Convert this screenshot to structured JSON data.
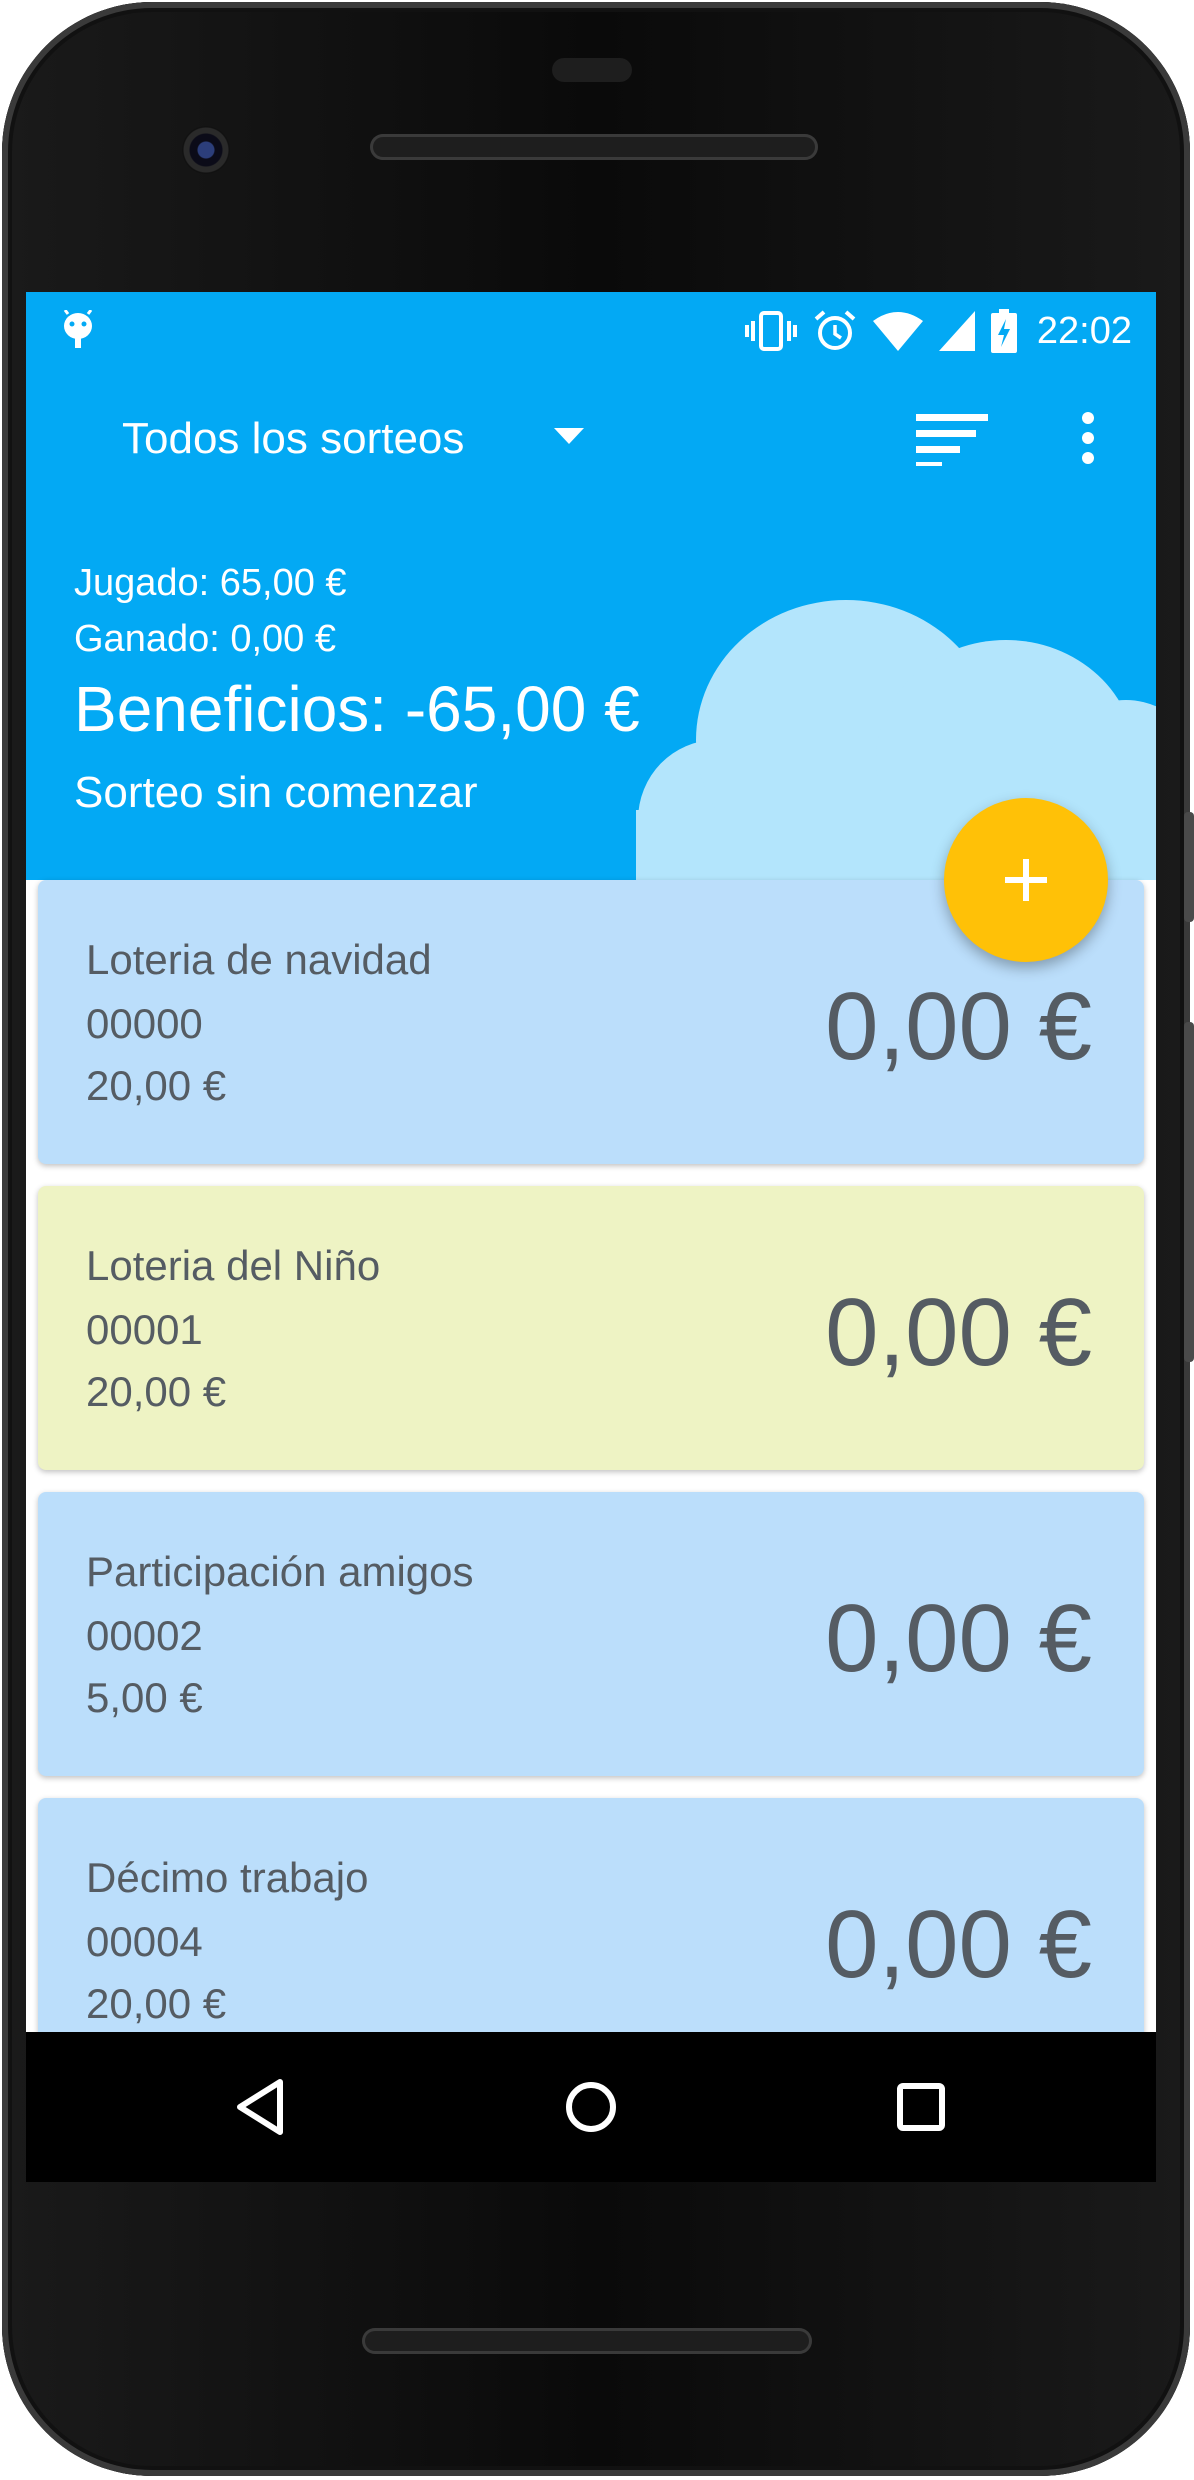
{
  "status_bar": {
    "time": "22:02",
    "icons": [
      "android-icon",
      "vibrate-icon",
      "alarm-icon",
      "wifi-icon",
      "signal-icon",
      "battery-charging-icon"
    ]
  },
  "toolbar": {
    "title": "Todos los sorteos",
    "icons": [
      "dropdown-arrow-icon",
      "sort-icon",
      "more-vert-icon"
    ]
  },
  "summary": {
    "played": "Jugado: 65,00 €",
    "won": "Ganado: 0,00 €",
    "profit": "Beneficios: -65,00 €",
    "status": "Sorteo sin comenzar"
  },
  "fab": {
    "icon": "add-icon",
    "label": "+"
  },
  "tickets": [
    {
      "name": "Loteria de navidad",
      "number": "00000",
      "price": "20,00 €",
      "prize": "0,00 €",
      "color": "#bbdefb"
    },
    {
      "name": "Loteria del Niño",
      "number": "00001",
      "price": "20,00 €",
      "prize": "0,00 €",
      "color": "#eef3c4"
    },
    {
      "name": "Participación amigos",
      "number": "00002",
      "price": "5,00 €",
      "prize": "0,00 €",
      "color": "#bbdefb"
    },
    {
      "name": "Décimo trabajo",
      "number": "00004",
      "price": "20,00 €",
      "prize": "0,00 €",
      "color": "#bbdefb"
    }
  ],
  "nav": {
    "icons": [
      "back-icon",
      "home-icon",
      "recents-icon"
    ]
  },
  "colors": {
    "primary": "#03a9f4",
    "accent": "#ffc107",
    "cloud": "#b3e5fc",
    "text": "#555c63"
  }
}
